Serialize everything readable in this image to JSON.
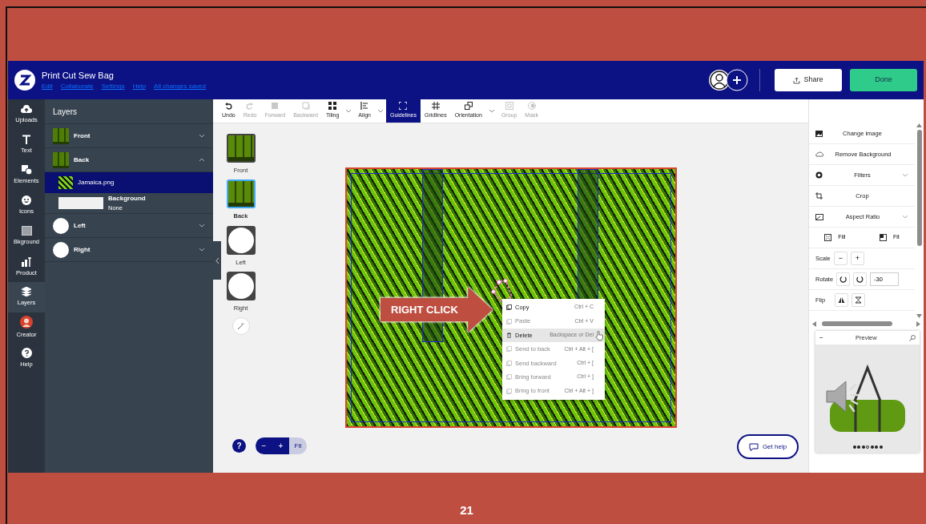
{
  "header": {
    "title": "Print Cut Sew Bag",
    "menu": [
      "Edit",
      "Collaborate",
      "Settings",
      "Help"
    ],
    "save_status": "All changes saved",
    "buttons": [
      {
        "label": "Share",
        "kind": "secondary"
      },
      {
        "label": "Done",
        "kind": "primary"
      }
    ]
  },
  "rail": [
    {
      "label": "Uploads",
      "selected": false
    },
    {
      "label": "Text",
      "selected": false
    },
    {
      "label": "Elements",
      "selected": false
    },
    {
      "label": "Icons",
      "selected": false
    },
    {
      "label": "Bkground",
      "selected": false
    },
    {
      "label": "Product",
      "selected": false
    },
    {
      "label": "Layers",
      "selected": true
    },
    {
      "label": "Creator",
      "selected": false
    },
    {
      "label": "Help",
      "selected": false
    }
  ],
  "layers_panel": {
    "title": "Layers",
    "layers": [
      {
        "name": "Front",
        "kind": "pattern",
        "expanded": false
      },
      {
        "name": "Back",
        "kind": "pattern",
        "expanded": true,
        "children": [
          {
            "name": "Jamaica.png",
            "kind": "image",
            "selected": true
          },
          {
            "name": "Background",
            "kind": "background",
            "detail": "None",
            "selected": false
          }
        ]
      },
      {
        "name": "Left",
        "kind": "circle",
        "expanded": false
      },
      {
        "name": "Right",
        "kind": "circle",
        "expanded": false
      }
    ]
  },
  "toolbar": [
    {
      "label": "Undo",
      "disabled": false,
      "selected": false,
      "dropdown": false
    },
    {
      "label": "Redo",
      "disabled": true,
      "selected": false,
      "dropdown": false
    },
    {
      "label": "Forward",
      "disabled": true,
      "selected": false,
      "dropdown": false
    },
    {
      "label": "Backward",
      "disabled": true,
      "selected": false,
      "dropdown": false
    },
    {
      "label": "Tiling",
      "disabled": false,
      "selected": false,
      "dropdown": true
    },
    {
      "label": "Align",
      "disabled": false,
      "selected": false,
      "dropdown": true
    },
    {
      "label": "Guidelines",
      "disabled": false,
      "selected": true,
      "dropdown": false
    },
    {
      "label": "Gridlines",
      "disabled": false,
      "selected": false,
      "dropdown": false
    },
    {
      "label": "Orientation",
      "disabled": false,
      "selected": false,
      "dropdown": true
    },
    {
      "label": "Group",
      "disabled": true,
      "selected": false,
      "dropdown": false
    },
    {
      "label": "Mask",
      "disabled": true,
      "selected": false,
      "dropdown": false
    }
  ],
  "pages": [
    {
      "label": "Front",
      "kind": "pattern",
      "selected": false
    },
    {
      "label": "Back",
      "kind": "pattern",
      "selected": true
    },
    {
      "label": "Left",
      "kind": "circle",
      "selected": false
    },
    {
      "label": "Right",
      "kind": "circle",
      "selected": false
    }
  ],
  "callout": {
    "text": "RIGHT CLICK"
  },
  "context_menu": [
    {
      "label": "Copy",
      "shortcut": "Ctrl + C",
      "disabled": false,
      "selected": false
    },
    {
      "label": "Paste",
      "shortcut": "Ctrl + V",
      "disabled": true,
      "selected": false
    },
    {
      "label": "Delete",
      "shortcut": "Backspace or Del",
      "disabled": false,
      "selected": true
    },
    {
      "label": "Send to back",
      "shortcut": "Ctrl + Alt + [",
      "disabled": true,
      "selected": false
    },
    {
      "label": "Send backward",
      "shortcut": "Ctrl + [",
      "disabled": true,
      "selected": false
    },
    {
      "label": "Bring forward",
      "shortcut": "Ctrl + ]",
      "disabled": true,
      "selected": false
    },
    {
      "label": "Bring to front",
      "shortcut": "Ctrl + Alt + ]",
      "disabled": true,
      "selected": false
    }
  ],
  "zoom_controls": {
    "help": "?",
    "zoom_out": "−",
    "zoom_in": "+",
    "fit": "Fit"
  },
  "get_help": "Get help",
  "right_panel": {
    "actions": [
      {
        "label": "Change image",
        "dropdown": false
      },
      {
        "label": "Remove Background",
        "dropdown": false
      },
      {
        "label": "Filters",
        "dropdown": true
      },
      {
        "label": "Crop",
        "dropdown": false
      },
      {
        "label": "Aspect Ratio",
        "dropdown": true
      }
    ],
    "fit_options": [
      "Fill",
      "Fit"
    ],
    "scale": {
      "label": "Scale",
      "minus": "−",
      "plus": "+"
    },
    "rotate": {
      "label": "Rotate",
      "value": "-30"
    },
    "flip": {
      "label": "Flip"
    }
  },
  "preview": {
    "minimize": "−",
    "title": "Preview",
    "dots": [
      {
        "selected": false
      },
      {
        "selected": false
      },
      {
        "selected": false
      },
      {
        "selected": true
      },
      {
        "selected": false
      },
      {
        "selected": false
      },
      {
        "selected": false
      }
    ]
  },
  "slide": {
    "page_number": "21"
  }
}
